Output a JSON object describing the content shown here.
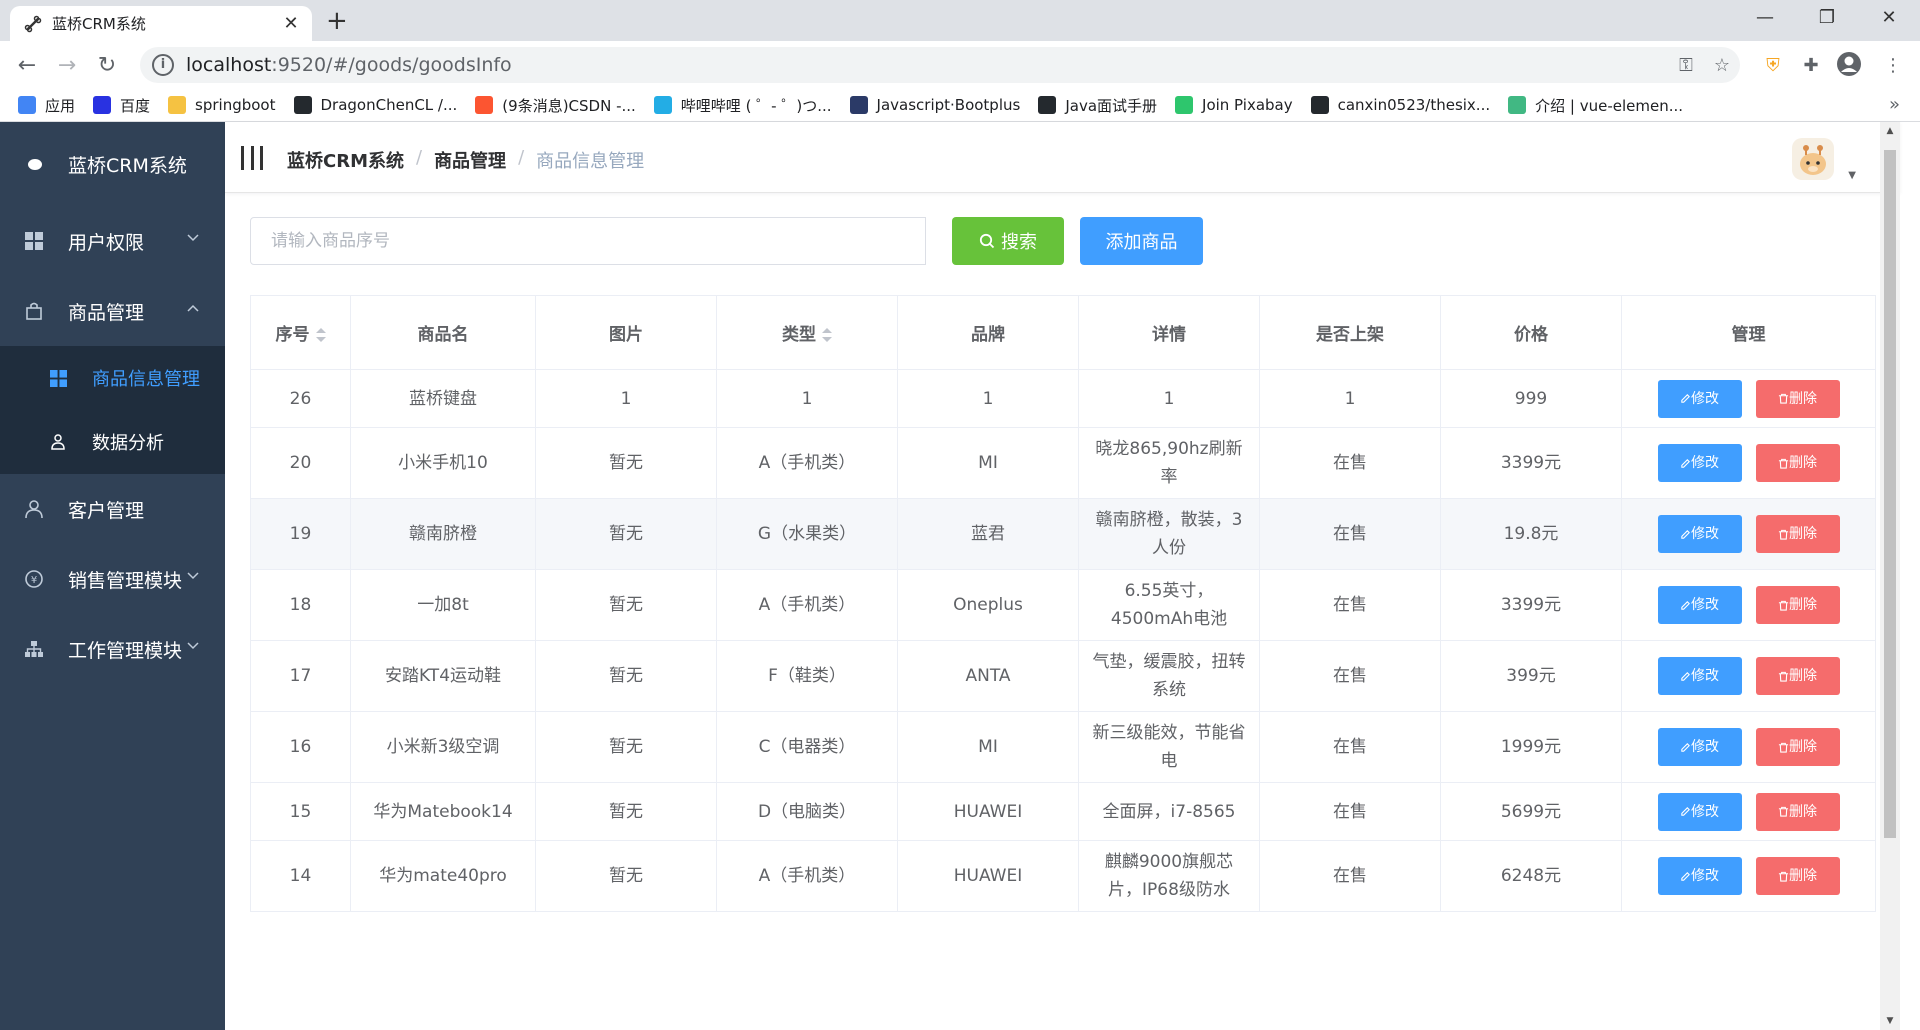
{
  "browser": {
    "tab_title": "蓝桥CRM系统",
    "tab_close": "✕",
    "new_tab": "+",
    "url_host": "localhost",
    "url_rest": ":9520/#/goods/goodsInfo",
    "window_controls": [
      "—",
      "❐",
      "✕"
    ],
    "bookmarks": [
      {
        "label": "应用",
        "icon": "apps-grid-icon",
        "color": "#4285f4"
      },
      {
        "label": "百度",
        "icon": "baidu-paw-icon",
        "color": "#2932e1"
      },
      {
        "label": "springboot",
        "icon": "folder-icon",
        "color": "#f5c242"
      },
      {
        "label": "DragonChenCL /...",
        "icon": "github-icon",
        "color": "#24292e"
      },
      {
        "label": "(9条消息)CSDN -...",
        "icon": "csdn-icon",
        "color": "#fc5531"
      },
      {
        "label": "哔哩哔哩 ( ゜- ゜)つ...",
        "icon": "bilibili-icon",
        "color": "#23ade5"
      },
      {
        "label": "Javascript·Bootplus",
        "icon": "bootplus-icon",
        "color": "#2b3a67"
      },
      {
        "label": "Java面试手册",
        "icon": "github-icon",
        "color": "#24292e"
      },
      {
        "label": "Join Pixabay",
        "icon": "pixabay-icon",
        "color": "#2ec66d"
      },
      {
        "label": "canxin0523/thesix...",
        "icon": "github-icon",
        "color": "#24292e"
      },
      {
        "label": "介绍 | vue-elemen...",
        "icon": "vue-icon",
        "color": "#41b883"
      }
    ],
    "bookmarks_more": "»"
  },
  "sidebar": {
    "logo_title": "蓝桥CRM系统",
    "items": [
      {
        "label": "用户权限",
        "icon": "grid-icon",
        "arrow": "⌄"
      },
      {
        "label": "商品管理",
        "icon": "bag-icon",
        "arrow": "⌃"
      },
      {
        "label": "客户管理",
        "icon": "user-icon",
        "arrow": ""
      },
      {
        "label": "销售管理模块",
        "icon": "money-icon",
        "arrow": "⌄"
      },
      {
        "label": "工作管理模块",
        "icon": "org-icon",
        "arrow": "⌄"
      }
    ],
    "sub_items": [
      {
        "label": "商品信息管理",
        "icon": "grid-icon"
      },
      {
        "label": "数据分析",
        "icon": "person-icon"
      }
    ]
  },
  "navbar": {
    "crumbs": [
      "蓝桥CRM系统",
      "商品管理",
      "商品信息管理"
    ],
    "separator": "/"
  },
  "toolbar": {
    "search_placeholder": "请输入商品序号",
    "search_label": "搜索",
    "add_label": "添加商品"
  },
  "table": {
    "headers": [
      "序号",
      "商品名",
      "图片",
      "类型",
      "品牌",
      "详情",
      "是否上架",
      "价格",
      "管理"
    ],
    "edit_label": "修改",
    "delete_label": "删除",
    "rows": [
      {
        "id": "26",
        "name": "蓝桥键盘",
        "image": "1",
        "type": "1",
        "brand": "1",
        "detail": "1",
        "status": "1",
        "price": "999"
      },
      {
        "id": "20",
        "name": "小米手机10",
        "image": "暂无",
        "type": "A（手机类）",
        "brand": "MI",
        "detail": "晓龙865,90hz刷新率",
        "status": "在售",
        "price": "3399元"
      },
      {
        "id": "19",
        "name": "赣南脐橙",
        "image": "暂无",
        "type": "G（水果类）",
        "brand": "蓝君",
        "detail": "赣南脐橙，散装，3人份",
        "status": "在售",
        "price": "19.8元"
      },
      {
        "id": "18",
        "name": "一加8t",
        "image": "暂无",
        "type": "A（手机类）",
        "brand": "Oneplus",
        "detail": "6.55英寸，4500mAh电池",
        "status": "在售",
        "price": "3399元"
      },
      {
        "id": "17",
        "name": "安踏KT4运动鞋",
        "image": "暂无",
        "type": "F（鞋类）",
        "brand": "ANTA",
        "detail": "气垫，缓震胶，扭转系统",
        "status": "在售",
        "price": "399元"
      },
      {
        "id": "16",
        "name": "小米新3级空调",
        "image": "暂无",
        "type": "C（电器类）",
        "brand": "MI",
        "detail": "新三级能效，节能省电",
        "status": "在售",
        "price": "1999元"
      },
      {
        "id": "15",
        "name": "华为Matebook14",
        "image": "暂无",
        "type": "D（电脑类）",
        "brand": "HUAWEI",
        "detail": "全面屏，i7-8565",
        "status": "在售",
        "price": "5699元"
      },
      {
        "id": "14",
        "name": "华为mate40pro",
        "image": "暂无",
        "type": "A（手机类）",
        "brand": "HUAWEI",
        "detail": "麒麟9000旗舰芯片，IP68级防水",
        "status": "在售",
        "price": "6248元"
      }
    ]
  }
}
